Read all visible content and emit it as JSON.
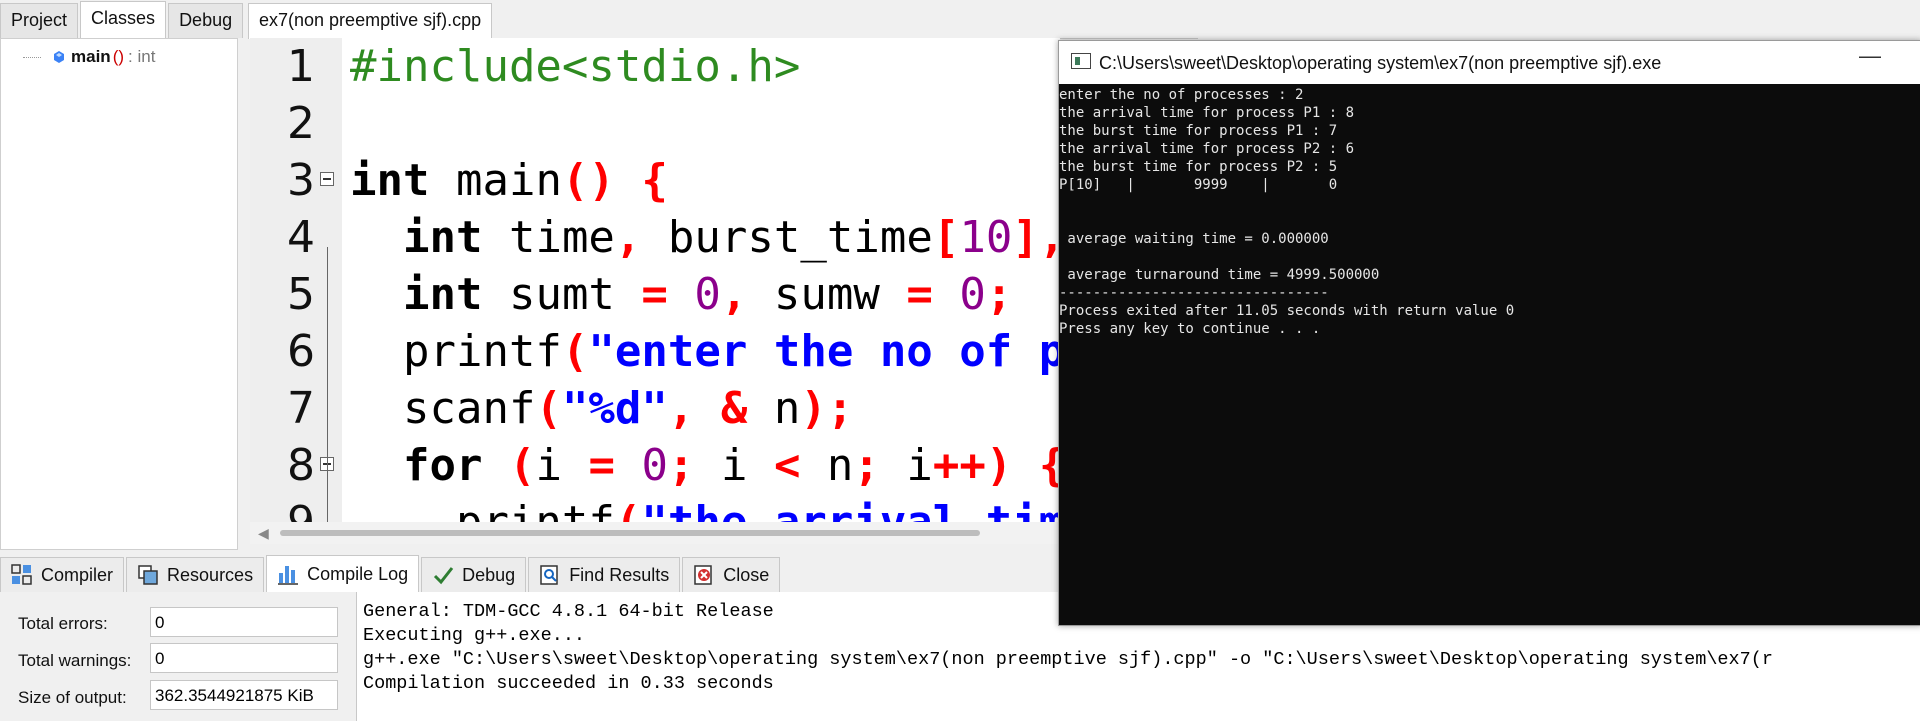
{
  "left_tabs": [
    "Project",
    "Classes",
    "Debug"
  ],
  "class_tree": {
    "name": "main",
    "parens": "()",
    "type": ": int"
  },
  "editor": {
    "file_tab": "ex7(non preemptive sjf).cpp",
    "line_numbers": [
      "1",
      "2",
      "3",
      "4",
      "5",
      "6",
      "7",
      "8",
      "9"
    ],
    "lines": [
      [
        {
          "t": "#include<stdio.h>",
          "c": "pre"
        }
      ],
      [],
      [
        {
          "t": "int",
          "c": "kw"
        },
        {
          "t": " main"
        },
        {
          "t": "() {",
          "c": "op"
        }
      ],
      [
        {
          "t": "  "
        },
        {
          "t": "int",
          "c": "kw"
        },
        {
          "t": " time"
        },
        {
          "t": ",",
          "c": "op"
        },
        {
          "t": " burst_time"
        },
        {
          "t": "[",
          "c": "op"
        },
        {
          "t": "10",
          "c": "num"
        },
        {
          "t": "],",
          "c": "op"
        }
      ],
      [
        {
          "t": "  "
        },
        {
          "t": "int",
          "c": "kw"
        },
        {
          "t": " sumt "
        },
        {
          "t": "=",
          "c": "op"
        },
        {
          "t": " "
        },
        {
          "t": "0",
          "c": "num"
        },
        {
          "t": ",",
          "c": "op"
        },
        {
          "t": " sumw "
        },
        {
          "t": "=",
          "c": "op"
        },
        {
          "t": " "
        },
        {
          "t": "0",
          "c": "num"
        },
        {
          "t": ";",
          "c": "op"
        }
      ],
      [
        {
          "t": "  printf"
        },
        {
          "t": "(",
          "c": "op"
        },
        {
          "t": "\"enter the no of p",
          "c": "str"
        }
      ],
      [
        {
          "t": "  scanf"
        },
        {
          "t": "(",
          "c": "op"
        },
        {
          "t": "\"%d\"",
          "c": "str"
        },
        {
          "t": ",",
          "c": "op"
        },
        {
          "t": " "
        },
        {
          "t": "&",
          "c": "op"
        },
        {
          "t": " n"
        },
        {
          "t": ");",
          "c": "op"
        }
      ],
      [
        {
          "t": "  "
        },
        {
          "t": "for",
          "c": "kw"
        },
        {
          "t": " "
        },
        {
          "t": "(",
          "c": "op"
        },
        {
          "t": "i "
        },
        {
          "t": "=",
          "c": "op"
        },
        {
          "t": " "
        },
        {
          "t": "0",
          "c": "num"
        },
        {
          "t": ";",
          "c": "op"
        },
        {
          "t": " i "
        },
        {
          "t": "<",
          "c": "op"
        },
        {
          "t": " n"
        },
        {
          "t": ";",
          "c": "op"
        },
        {
          "t": " i"
        },
        {
          "t": "++) {",
          "c": "op"
        }
      ],
      [
        {
          "t": "    printf"
        },
        {
          "t": "(",
          "c": "op"
        },
        {
          "t": "\"the arrival tim",
          "c": "str"
        }
      ]
    ]
  },
  "bottom_tabs": [
    {
      "label": "Compiler",
      "icon": "compiler-grid-icon"
    },
    {
      "label": "Resources",
      "icon": "resources-icon"
    },
    {
      "label": "Compile Log",
      "icon": "bar-chart-icon"
    },
    {
      "label": "Debug",
      "icon": "check-icon"
    },
    {
      "label": "Find Results",
      "icon": "find-results-icon"
    },
    {
      "label": "Close",
      "icon": "close-red-icon"
    }
  ],
  "stats": {
    "errors_label": "Total errors:",
    "errors": "0",
    "warnings_label": "Total warnings:",
    "warnings": "0",
    "size_label": "Size of output:",
    "size": "362.3544921875 KiB"
  },
  "compile_log": [
    "General: TDM-GCC 4.8.1 64-bit Release",
    "Executing g++.exe...",
    "g++.exe \"C:\\Users\\sweet\\Desktop\\operating system\\ex7(non preemptive sjf).cpp\" -o \"C:\\Users\\sweet\\Desktop\\operating system\\ex7(r",
    "Compilation succeeded in 0.33 seconds"
  ],
  "console": {
    "title": "C:\\Users\\sweet\\Desktop\\operating system\\ex7(non preemptive sjf).exe",
    "minimize": "—",
    "lines": [
      "enter the no of processes : 2",
      "the arrival time for process P1 : 8",
      "the burst time for process P1 : 7",
      "the arrival time for process P2 : 6",
      "the burst time for process P2 : 5",
      "P[10]   |       9999    |       0",
      "",
      "",
      " average waiting time = 0.000000",
      "",
      " average turnaround time = 4999.500000",
      "--------------------------------",
      "Process exited after 11.05 seconds with return value 0",
      "Press any key to continue . . ."
    ]
  }
}
